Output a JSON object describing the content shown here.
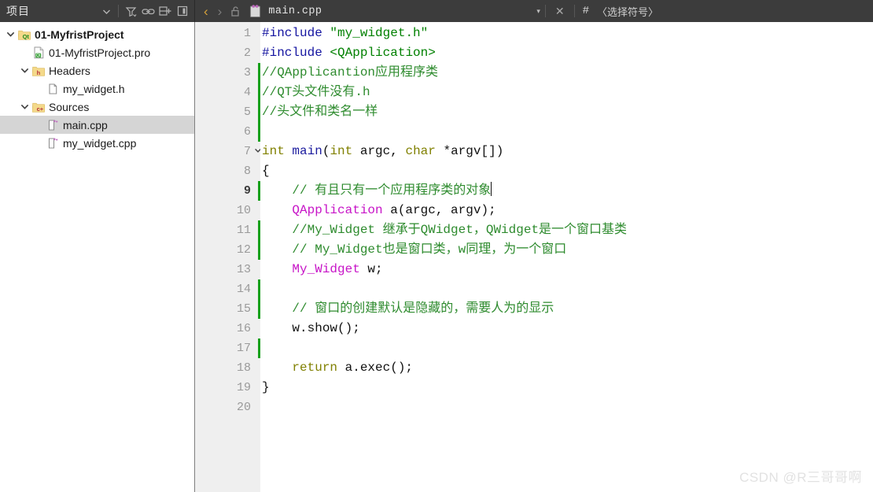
{
  "window": {
    "panel_title": "项目",
    "accent": "#17a01b",
    "topbar_bg": "#3c3c3c"
  },
  "panel_toolbar": {
    "items": [
      {
        "name": "chevron-down-icon",
        "label": "▾"
      },
      {
        "name": "filter-icon",
        "label": "filter"
      },
      {
        "name": "link-icon",
        "label": "link"
      },
      {
        "name": "split-add-icon",
        "label": "split"
      },
      {
        "name": "close-panel-icon",
        "label": "close"
      }
    ]
  },
  "editor_toolbar": {
    "back_label": "‹",
    "forward_label": "›",
    "lock_name": "unlocked-padlock-icon",
    "file_icon_name": "document-icon",
    "filename": "main.cpp",
    "dropdown_label": "▾",
    "close_label": "✕",
    "hash_label": "#",
    "symbol_selector": "〈选择符号〉"
  },
  "sidebar": {
    "items": [
      {
        "label": "01-MyfristProject",
        "depth": 0,
        "expanded": true,
        "icon": "qt-project-folder-icon",
        "bold": true,
        "selected": false
      },
      {
        "label": "01-MyfristProject.pro",
        "depth": 1,
        "expanded": null,
        "icon": "qt-pro-file-icon",
        "bold": false,
        "selected": false
      },
      {
        "label": "Headers",
        "depth": 1,
        "expanded": true,
        "icon": "headers-folder-icon",
        "bold": false,
        "selected": false
      },
      {
        "label": "my_widget.h",
        "depth": 2,
        "expanded": null,
        "icon": "header-file-icon",
        "bold": false,
        "selected": false
      },
      {
        "label": "Sources",
        "depth": 1,
        "expanded": true,
        "icon": "sources-folder-icon",
        "bold": false,
        "selected": false
      },
      {
        "label": "main.cpp",
        "depth": 2,
        "expanded": null,
        "icon": "cpp-file-icon",
        "bold": false,
        "selected": true
      },
      {
        "label": "my_widget.cpp",
        "depth": 2,
        "expanded": null,
        "icon": "cpp-file-icon",
        "bold": false,
        "selected": false
      }
    ]
  },
  "code": {
    "current_line": 9,
    "lines": [
      {
        "n": 1,
        "changed": false,
        "fold": false,
        "tokens": [
          {
            "t": "pre",
            "v": "#include "
          },
          {
            "t": "str",
            "v": "\"my_widget.h\""
          }
        ]
      },
      {
        "n": 2,
        "changed": false,
        "fold": false,
        "tokens": [
          {
            "t": "pre",
            "v": "#include "
          },
          {
            "t": "str",
            "v": "<QApplication>"
          }
        ]
      },
      {
        "n": 3,
        "changed": true,
        "fold": false,
        "tokens": [
          {
            "t": "cmt",
            "v": "//QApplicantion应用程序类"
          }
        ]
      },
      {
        "n": 4,
        "changed": true,
        "fold": false,
        "tokens": [
          {
            "t": "cmt",
            "v": "//QT头文件没有.h"
          }
        ]
      },
      {
        "n": 5,
        "changed": true,
        "fold": false,
        "tokens": [
          {
            "t": "cmt",
            "v": "//头文件和类名一样"
          }
        ]
      },
      {
        "n": 6,
        "changed": true,
        "fold": false,
        "tokens": []
      },
      {
        "n": 7,
        "changed": false,
        "fold": true,
        "tokens": [
          {
            "t": "kw",
            "v": "int"
          },
          {
            "t": "pl",
            "v": " "
          },
          {
            "t": "fn",
            "v": "main"
          },
          {
            "t": "pl",
            "v": "("
          },
          {
            "t": "kw",
            "v": "int"
          },
          {
            "t": "pl",
            "v": " argc, "
          },
          {
            "t": "kw",
            "v": "char"
          },
          {
            "t": "pl",
            "v": " *argv[])"
          }
        ]
      },
      {
        "n": 8,
        "changed": false,
        "fold": false,
        "tokens": [
          {
            "t": "pl",
            "v": "{"
          }
        ]
      },
      {
        "n": 9,
        "changed": true,
        "fold": false,
        "caret": true,
        "tokens": [
          {
            "t": "pl",
            "v": "    "
          },
          {
            "t": "cmt",
            "v": "// 有且只有一个应用程序类的对象"
          }
        ]
      },
      {
        "n": 10,
        "changed": false,
        "fold": false,
        "tokens": [
          {
            "t": "pl",
            "v": "    "
          },
          {
            "t": "type",
            "v": "QApplication"
          },
          {
            "t": "pl",
            "v": " a(argc, argv);"
          }
        ]
      },
      {
        "n": 11,
        "changed": true,
        "fold": false,
        "tokens": [
          {
            "t": "pl",
            "v": "    "
          },
          {
            "t": "cmt",
            "v": "//My_Widget 继承于QWidget，QWidget是一个窗口基类"
          }
        ]
      },
      {
        "n": 12,
        "changed": true,
        "fold": false,
        "tokens": [
          {
            "t": "pl",
            "v": "    "
          },
          {
            "t": "cmt",
            "v": "// My_Widget也是窗口类，w同理，为一个窗口"
          }
        ]
      },
      {
        "n": 13,
        "changed": false,
        "fold": false,
        "tokens": [
          {
            "t": "pl",
            "v": "    "
          },
          {
            "t": "type",
            "v": "My_Widget"
          },
          {
            "t": "pl",
            "v": " w;"
          }
        ]
      },
      {
        "n": 14,
        "changed": true,
        "fold": false,
        "tokens": []
      },
      {
        "n": 15,
        "changed": true,
        "fold": false,
        "tokens": [
          {
            "t": "pl",
            "v": "    "
          },
          {
            "t": "cmt",
            "v": "// 窗口的创建默认是隐藏的，需要人为的显示"
          }
        ]
      },
      {
        "n": 16,
        "changed": false,
        "fold": false,
        "tokens": [
          {
            "t": "pl",
            "v": "    w.show();"
          }
        ]
      },
      {
        "n": 17,
        "changed": true,
        "fold": false,
        "tokens": []
      },
      {
        "n": 18,
        "changed": false,
        "fold": false,
        "tokens": [
          {
            "t": "pl",
            "v": "    "
          },
          {
            "t": "kw",
            "v": "return"
          },
          {
            "t": "pl",
            "v": " a.exec();"
          }
        ]
      },
      {
        "n": 19,
        "changed": false,
        "fold": false,
        "tokens": [
          {
            "t": "pl",
            "v": "}"
          }
        ]
      },
      {
        "n": 20,
        "changed": false,
        "fold": false,
        "tokens": []
      }
    ]
  },
  "watermark": {
    "text": "CSDN @R三哥哥啊"
  }
}
